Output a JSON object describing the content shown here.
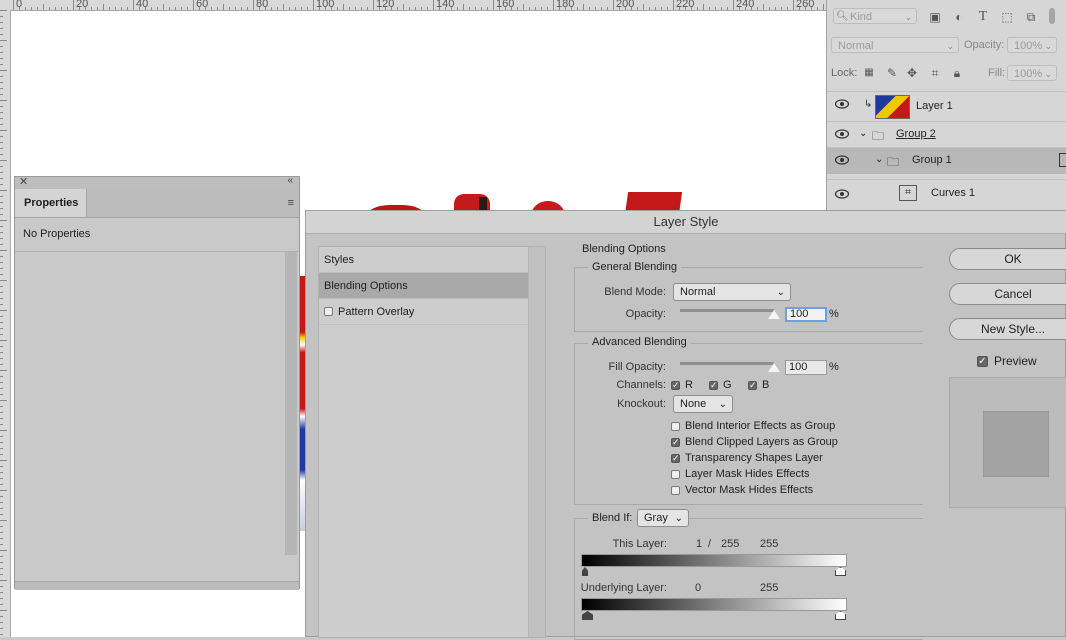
{
  "ruler": {
    "labels": [
      "0",
      "20",
      "40",
      "60",
      "80",
      "100",
      "120",
      "140",
      "160",
      "180",
      "200",
      "220",
      "240",
      "260"
    ]
  },
  "layers_panel": {
    "filter_kind": "Kind",
    "blend_mode": "Normal",
    "opacity_label": "Opacity:",
    "opacity_value": "100%",
    "lock_label": "Lock:",
    "fill_label": "Fill:",
    "fill_value": "100%",
    "layers": [
      {
        "name": "Layer 1"
      },
      {
        "name": "Group 2"
      },
      {
        "name": "Group 1"
      },
      {
        "name": "Curves 1"
      }
    ]
  },
  "properties_panel": {
    "tab": "Properties",
    "body_text": "No Properties"
  },
  "dialog": {
    "title": "Layer Style",
    "styles": {
      "header": "Styles",
      "items": [
        {
          "label": "Blending Options"
        },
        {
          "label": "Pattern Overlay"
        }
      ]
    },
    "blending_options": "Blending Options",
    "general": {
      "legend": "General Blending",
      "blend_mode_label": "Blend Mode:",
      "blend_mode_value": "Normal",
      "opacity_label": "Opacity:",
      "opacity_value": "100",
      "opacity_level": 1.0,
      "percent": "%"
    },
    "advanced": {
      "legend": "Advanced Blending",
      "fill_opacity_label": "Fill Opacity:",
      "fill_opacity_value": "100",
      "fill_opacity_level": 1.0,
      "percent": "%",
      "channels_label": "Channels:",
      "channels": [
        "R",
        "G",
        "B"
      ],
      "knockout_label": "Knockout:",
      "knockout_value": "None",
      "options": [
        {
          "label": "Blend Interior Effects as Group",
          "checked": false
        },
        {
          "label": "Blend Clipped Layers as Group",
          "checked": true
        },
        {
          "label": "Transparency Shapes Layer",
          "checked": true
        },
        {
          "label": "Layer Mask Hides Effects",
          "checked": false
        },
        {
          "label": "Vector Mask Hides Effects",
          "checked": false
        }
      ]
    },
    "blend_if": {
      "legend": "Blend If:",
      "value": "Gray",
      "this_layer_label": "This Layer:",
      "this_layer_low": "1",
      "this_layer_sep": "/",
      "this_layer_mid": "255",
      "this_layer_high": "255",
      "underlying_label": "Underlying Layer:",
      "underlying_low": "0",
      "underlying_high": "255"
    },
    "buttons": {
      "ok": "OK",
      "cancel": "Cancel",
      "new_style": "New Style...",
      "preview": "Preview"
    }
  },
  "colors": {
    "accent_focus": "#6aa0e6",
    "red": "#c8181c",
    "blue": "#1e3aa0",
    "yellow": "#f0c800"
  }
}
